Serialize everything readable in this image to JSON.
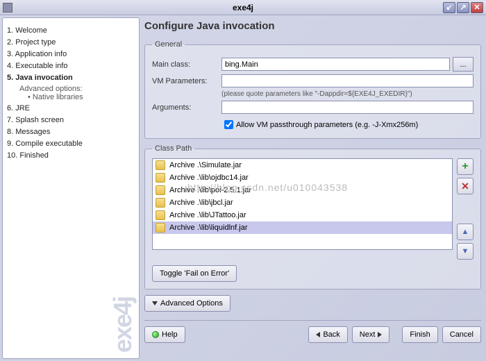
{
  "titlebar": {
    "title": "exe4j"
  },
  "sidebar": {
    "steps": [
      {
        "label": "1. Welcome"
      },
      {
        "label": "2. Project type"
      },
      {
        "label": "3. Application info"
      },
      {
        "label": "4. Executable info"
      },
      {
        "label": "5. Java invocation"
      },
      {
        "label": "6. JRE"
      },
      {
        "label": "7. Splash screen"
      },
      {
        "label": "8. Messages"
      },
      {
        "label": "9. Compile executable"
      },
      {
        "label": "10. Finished"
      }
    ],
    "advanced_label": "Advanced options:",
    "native_label": "Native libraries",
    "brand": "exe4j"
  },
  "page": {
    "title": "Configure Java invocation"
  },
  "general": {
    "legend": "General",
    "main_class_label": "Main class:",
    "main_class_value": "bing.Main",
    "browse_label": "...",
    "vm_params_label": "VM Parameters:",
    "vm_params_value": "",
    "vm_hint": "(please quote parameters like \"-Dappdir=${EXE4J_EXEDIR}\")",
    "args_label": "Arguments:",
    "args_value": "",
    "allow_passthrough_label": "Allow VM passthrough parameters (e.g. -J-Xmx256m)",
    "allow_passthrough_checked": true
  },
  "classpath": {
    "legend": "Class Path",
    "items": [
      {
        "type": "Archive",
        "path": ".\\Simulate.jar"
      },
      {
        "type": "Archive",
        "path": ".\\lib\\ojdbc14.jar"
      },
      {
        "type": "Archive",
        "path": ".\\lib\\poi-2.5.1.jar"
      },
      {
        "type": "Archive",
        "path": ".\\lib\\jbcl.jar"
      },
      {
        "type": "Archive",
        "path": ".\\lib\\JTattoo.jar"
      },
      {
        "type": "Archive",
        "path": ".\\lib\\liquidlnf.jar"
      }
    ],
    "selected_index": 5,
    "toggle_label": "Toggle 'Fail on Error'"
  },
  "advanced_btn": "Advanced Options",
  "footer": {
    "help": "Help",
    "back": "Back",
    "next": "Next",
    "finish": "Finish",
    "cancel": "Cancel"
  },
  "watermark": "http://blog.csdn.net/u010043538"
}
